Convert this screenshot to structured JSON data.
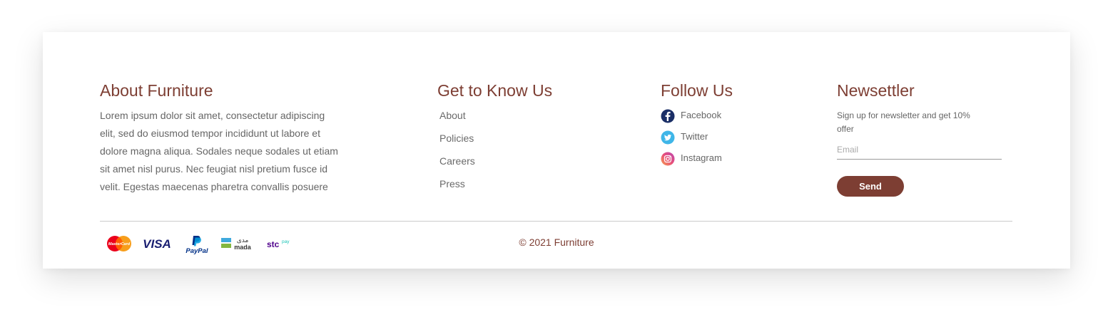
{
  "about": {
    "title": "About Furniture",
    "text": "Lorem ipsum dolor sit amet, consectetur adipiscing elit, sed do eiusmod tempor incididunt ut labore et dolore magna aliqua. Sodales neque sodales ut etiam sit amet nisl purus. Nec feugiat nisl pretium fusce id velit. Egestas maecenas pharetra convallis posuere"
  },
  "know": {
    "title": "Get to Know Us",
    "links": [
      "About",
      "Policies",
      "Careers",
      "Press"
    ]
  },
  "follow": {
    "title": "Follow Us",
    "items": [
      {
        "label": "Facebook",
        "icon": "facebook-icon",
        "color": "#1a2e66"
      },
      {
        "label": "Twitter",
        "icon": "twitter-icon",
        "color": "#3fb6e8"
      },
      {
        "label": "Instagram",
        "icon": "instagram-icon",
        "color": "#e8507a"
      }
    ]
  },
  "newsletter": {
    "title": "Newsettler",
    "text": "Sign up for newsletter and get 10% offer",
    "placeholder": "Email",
    "button": "Send"
  },
  "payments": {
    "methods": [
      "mastercard",
      "visa",
      "paypal",
      "mada",
      "stc-pay"
    ],
    "mastercard": "MasterCard",
    "visa": "VISA",
    "paypal": "PayPal",
    "mada_arabic": "مدى",
    "mada": "mada",
    "stc": "stc",
    "stc_pay": "pay"
  },
  "copyright": "© 2021 Furniture",
  "colors": {
    "brand": "#7d3e33",
    "text": "#666666"
  }
}
